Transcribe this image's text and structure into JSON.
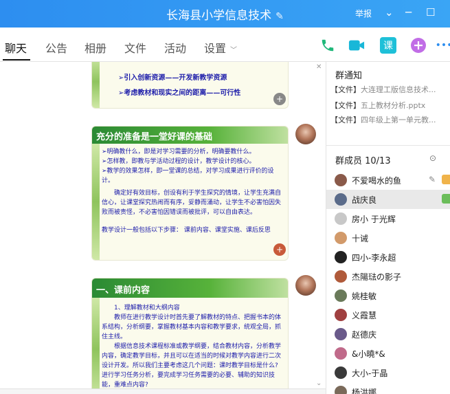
{
  "window": {
    "title": "长海县小学信息技术",
    "edit_glyph": "✎",
    "report": "举报",
    "controls": {
      "dropdown": "⌄",
      "minimize": "─",
      "maximize": "☐",
      "close": "✕"
    }
  },
  "tabs": [
    {
      "label": "聊天"
    },
    {
      "label": "公告"
    },
    {
      "label": "相册"
    },
    {
      "label": "文件"
    },
    {
      "label": "活动"
    },
    {
      "label": "设置"
    }
  ],
  "tools": {
    "call_icon": "phone-icon",
    "video_icon": "video-icon",
    "course_label": "课",
    "more": "•••"
  },
  "chat": {
    "slide1": {
      "lines": [
        "➢引入创新资源——开发新教学资源",
        "➢考虑教材和现实之间的距离——可行性"
      ]
    },
    "slide2": {
      "heading": "充分的准备是一堂好课的基础",
      "lines": [
        "➢明确教什么，即是对学习需要的分析，明确要教什么。",
        "➢怎样教，即教与学活动过程的设计，教学设计的核心。",
        "➢教学的效果怎样，即一堂课的总结，对学习成果进行评价的设计。",
        "确定好有效目标，创设有利于学生探究的情境，让学生充满自信心，让课堂探究热闹而有序，妥静而涌动，让学生不必害怕因失败而被责怪，不必害怕因错误而被批评，可以自由表达。",
        "教学设计一般包括以下步骤：  课前内容、课堂实施、课后反思"
      ]
    },
    "slide3": {
      "heading": "一、课前内容",
      "lines": [
        "1、理解教材和大纲内容",
        "教师在进行教学设计时首先要了解教材的特点、把握书本的体系结构，分析纲要，掌握教材基本内容和教学要求，统观全局，抓住主线。",
        "根据信息技术课程标准或教学纲要，结合教材内容，分析教学内容，确定教学目标，并且可以在适当的时候对教学内容进行二次设计开发。所以我们主要考虑这几个问题：课时教学目标是什么?进行学习任务分析，要完成学习任务需要的必要、辅助的知识技能，重难点内容?"
      ]
    }
  },
  "notices": {
    "title": "群通知",
    "items": [
      {
        "tag": "【文件】",
        "name": "大连理工版信息技术..."
      },
      {
        "tag": "【文件】",
        "name": "五上教材分析.pptx"
      },
      {
        "tag": "【文件】",
        "name": "四年级上第一单元教..."
      }
    ]
  },
  "members": {
    "title": "群成员 10/13",
    "list": [
      {
        "name": "不爱喝水的鱼",
        "color": "#8a5a4a"
      },
      {
        "name": "战庆良",
        "color": "#5a6b8a"
      },
      {
        "name": "房小   于光辉",
        "color": "#c8c8c8"
      },
      {
        "name": "十诫",
        "color": "#d29a6a"
      },
      {
        "name": "四小-李永超",
        "color": "#222222"
      },
      {
        "name": "杰陽琺の影子",
        "color": "#b05a3a"
      },
      {
        "name": "姚桂敏",
        "color": "#6a7a5a"
      },
      {
        "name": "义霞慧",
        "color": "#a04040"
      },
      {
        "name": "赵德庆",
        "color": "#6a5a8a"
      },
      {
        "name": "&小曉*&",
        "color": "#c06a8a"
      },
      {
        "name": "大小-于晶",
        "color": "#3a3a3a"
      },
      {
        "name": "杨洪娜",
        "color": "#7a6a5a"
      }
    ]
  }
}
